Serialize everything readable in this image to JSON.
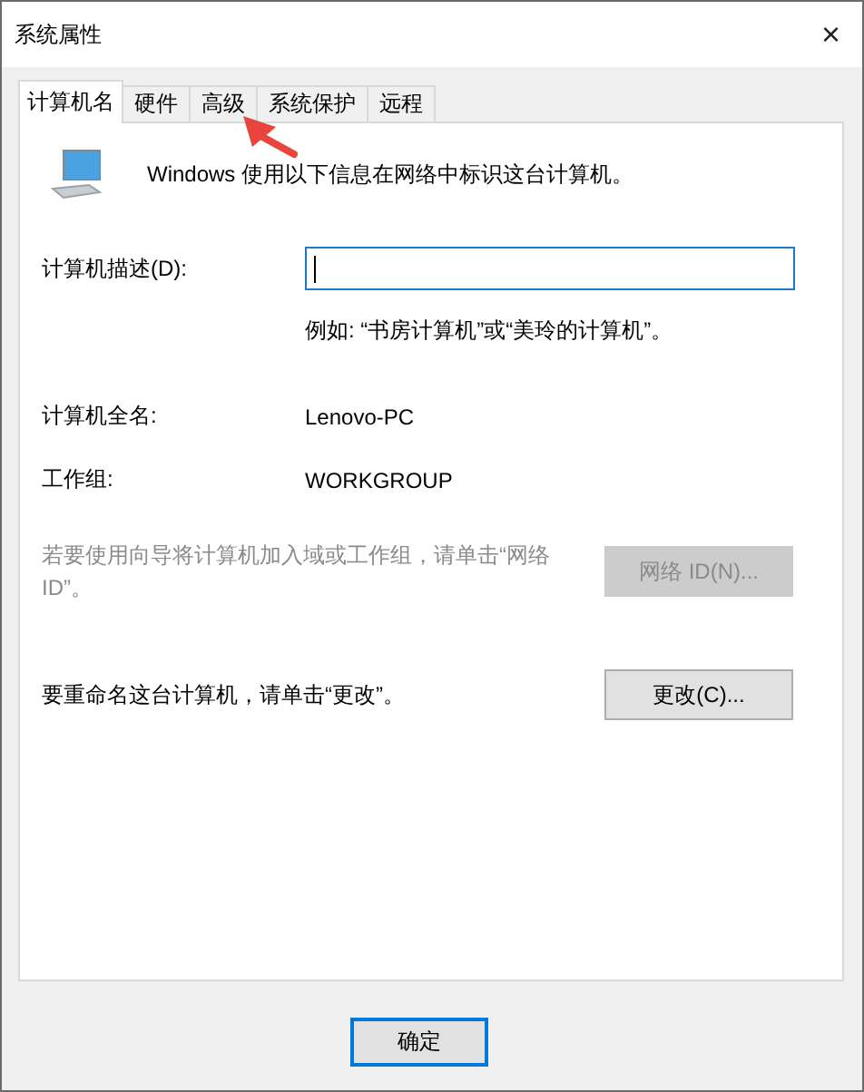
{
  "window": {
    "title": "系统属性",
    "close": "×"
  },
  "tabs": [
    {
      "label": "计算机名",
      "selected": true
    },
    {
      "label": "硬件",
      "selected": false
    },
    {
      "label": "高级",
      "selected": false
    },
    {
      "label": "系统保护",
      "selected": false
    },
    {
      "label": "远程",
      "selected": false
    }
  ],
  "intro": "Windows 使用以下信息在网络中标识这台计算机。",
  "description": {
    "label": "计算机描述(D):",
    "focused": true,
    "hint": "例如: “书房计算机”或“美玲的计算机”。"
  },
  "info": [
    {
      "label": "计算机全名:",
      "value": "Lenovo-PC"
    },
    {
      "label": "工作组:",
      "value": "WORKGROUP"
    }
  ],
  "actions": [
    {
      "text": "若要使用向导将计算机加入域或工作组，请单击“网络 ID”。",
      "button": "网络 ID(N)...",
      "disabled": true
    },
    {
      "text": "要重命名这台计算机，请单击“更改”。",
      "button": "更改(C)...",
      "disabled": false
    }
  ],
  "footer_buttons": [
    {
      "label": "确定",
      "default": true
    }
  ],
  "annotations": [
    {
      "kind": "arrow"
    }
  ]
}
